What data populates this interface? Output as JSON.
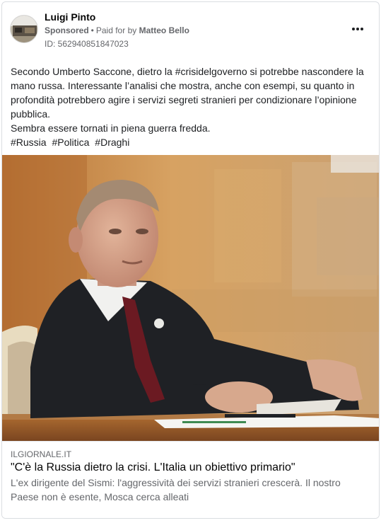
{
  "post": {
    "author": "Luigi Pinto",
    "sponsored_label": "Sponsored",
    "separator": "•",
    "paid_for_label": "Paid for by",
    "payer": "Matteo Bello",
    "id_text": "ID: 562940851847023",
    "more_icon": "more-horizontal-icon"
  },
  "body": {
    "paragraph1": "Secondo Umberto Saccone, dietro la #crisidelgoverno si potrebbe nascondere la mano russa. Interessante l’analisi che mostra, anche con esempi, su quanto in profondità potrebbero agire i servizi segreti stranieri per condizionare l’opinione pubblica.",
    "paragraph2": "Sembra essere tornati in piena guerra fredda.",
    "hashtags": [
      "#Russia",
      "#Politica",
      "#Draghi"
    ]
  },
  "link": {
    "domain": "ILGIORNALE.IT",
    "headline": "\"C'è la Russia dietro la crisi. L'Italia un obiettivo primario\"",
    "description": "L'ex dirigente del Sismi: l'aggressività dei servizi stranieri crescerà. Il nostro Paese non è esente, Mosca cerca alleati"
  },
  "colors": {
    "text_primary": "#050505",
    "text_secondary": "#65676b",
    "border": "#dadde1",
    "image_background": "#c98a45",
    "suit": "#1f2125",
    "tie": "#6b1a22"
  }
}
